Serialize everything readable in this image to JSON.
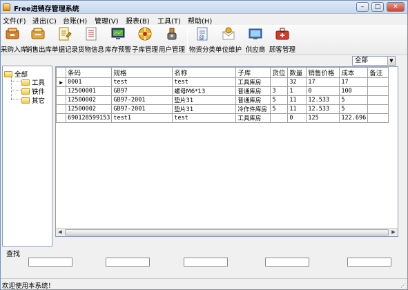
{
  "window": {
    "title": "Free进销存管理系统"
  },
  "controls": {
    "minimize": "–",
    "maximize": "□",
    "close": "✕"
  },
  "menu": [
    "文件(F)",
    "进出(C)",
    "台账(H)",
    "管理(V)",
    "报表(B)",
    "工具(T)",
    "帮助(H)"
  ],
  "toolbar": [
    {
      "label": "采购入库",
      "icon": "purchase-in-icon"
    },
    {
      "label": "销售出库",
      "icon": "sales-out-icon"
    },
    {
      "label": "单据记录",
      "icon": "document-record-icon"
    },
    {
      "label": "货物信息",
      "icon": "goods-info-icon"
    },
    {
      "label": "库存预警",
      "icon": "stock-warning-icon"
    },
    {
      "label": "子库管理",
      "icon": "sub-warehouse-icon"
    },
    {
      "label": "用户管理",
      "icon": "user-management-icon"
    },
    {
      "label": "物资分类",
      "icon": "material-category-icon"
    },
    {
      "label": "单位维护",
      "icon": "unit-maintenance-icon"
    },
    {
      "label": "供应商",
      "icon": "supplier-icon"
    },
    {
      "label": "顾客管理",
      "icon": "customer-icon"
    }
  ],
  "tree": {
    "root": "全部",
    "children": [
      "工具",
      "铁件",
      "其它"
    ]
  },
  "filter": {
    "selected": "全部"
  },
  "grid": {
    "columns": [
      "条码",
      "规格",
      "名称",
      "子库",
      "货位",
      "数量",
      "销售价格",
      "成本",
      "备注"
    ],
    "rows": [
      [
        "0001",
        "test",
        "test",
        "工具库房",
        "",
        "32",
        "17",
        "17",
        ""
      ],
      [
        "12500001",
        "GB97",
        "螺母M6*13",
        "普通库房",
        "3",
        "1",
        "0",
        "100",
        ""
      ],
      [
        "12500002",
        "GB97-2001",
        "垫片31",
        "普通库房",
        "5",
        "11",
        "12.533",
        "5",
        ""
      ],
      [
        "12500002",
        "GB97-2001",
        "垫片31",
        "冷作件库房",
        "5",
        "11",
        "12.533",
        "5",
        ""
      ],
      [
        "690128599153",
        "test1",
        "test",
        "工具库房",
        "",
        "0",
        "125",
        "122.696",
        ""
      ]
    ]
  },
  "search": {
    "label": "查找"
  },
  "status": {
    "text": "欢迎使用本系统！"
  }
}
